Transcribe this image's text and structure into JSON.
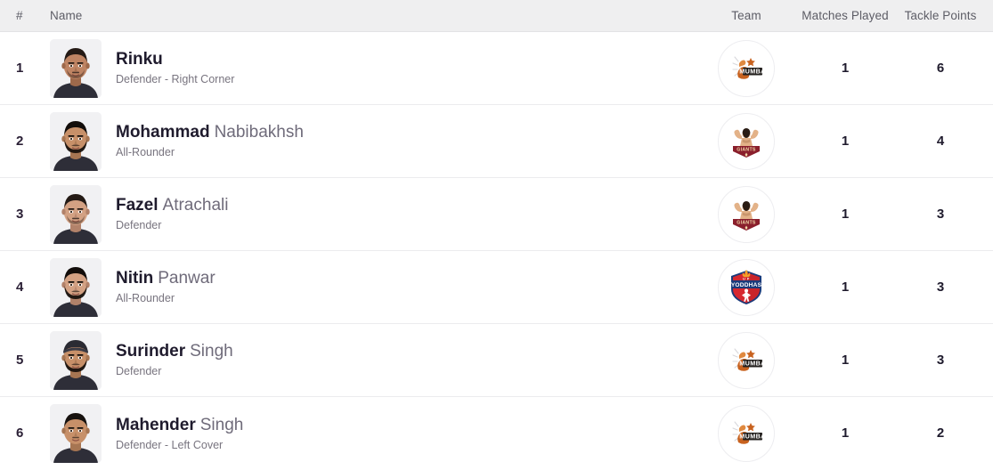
{
  "table": {
    "columns": {
      "rank": "#",
      "name": "Name",
      "team": "Team",
      "matches_played": "Matches Played",
      "tackle_points": "Tackle Points"
    },
    "rows": [
      {
        "rank": "1",
        "first_name": "Rinku",
        "last_name": "",
        "role": "Defender - Right Corner",
        "team": "U Mumba",
        "team_logo": "u-mumba-logo",
        "matches_played": "1",
        "tackle_points": "6",
        "avatar": "player-headshot-rinku"
      },
      {
        "rank": "2",
        "first_name": "Mohammad",
        "last_name": "Nabibakhsh",
        "role": "All-Rounder",
        "team": "Gujarat Giants",
        "team_logo": "gujarat-giants-logo",
        "matches_played": "1",
        "tackle_points": "4",
        "avatar": "player-headshot-mohammad-nabibakhsh"
      },
      {
        "rank": "3",
        "first_name": "Fazel",
        "last_name": "Atrachali",
        "role": "Defender",
        "team": "Gujarat Giants",
        "team_logo": "gujarat-giants-logo",
        "matches_played": "1",
        "tackle_points": "3",
        "avatar": "player-headshot-fazel-atrachali"
      },
      {
        "rank": "4",
        "first_name": "Nitin",
        "last_name": "Panwar",
        "role": "All-Rounder",
        "team": "UP Yoddhas",
        "team_logo": "up-yoddhas-logo",
        "matches_played": "1",
        "tackle_points": "3",
        "avatar": "player-headshot-nitin-panwar"
      },
      {
        "rank": "5",
        "first_name": "Surinder",
        "last_name": "Singh",
        "role": "Defender",
        "team": "U Mumba",
        "team_logo": "u-mumba-logo",
        "matches_played": "1",
        "tackle_points": "3",
        "avatar": "player-headshot-surinder-singh"
      },
      {
        "rank": "6",
        "first_name": "Mahender",
        "last_name": "Singh",
        "role": "Defender - Left Cover",
        "team": "U Mumba",
        "team_logo": "u-mumba-logo",
        "matches_played": "1",
        "tackle_points": "2",
        "avatar": "player-headshot-mahender-singh"
      }
    ]
  },
  "colors": {
    "header_bg": "#efeff0",
    "row_bg": "#ffffff",
    "divider": "#ececee",
    "name_primary": "#1f1b2d",
    "name_secondary": "#6f6b7a",
    "role_text": "#78747f",
    "header_text": "#5d5d66",
    "u_mumba_orange": "#c8621f",
    "gujarat_maroon": "#8a1f2c",
    "yoddhas_red": "#d7282f",
    "yoddhas_blue": "#1b3a7a"
  }
}
